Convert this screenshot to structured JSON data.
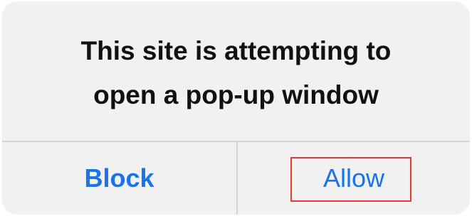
{
  "dialog": {
    "message_lines": [
      "This site is attempting to",
      "open a pop-up window"
    ],
    "block_label": "Block",
    "allow_label": "Allow"
  },
  "colors": {
    "button_text": "#1a73e8",
    "highlight_border": "#e0393e",
    "dialog_background": "#f1f1f2"
  }
}
